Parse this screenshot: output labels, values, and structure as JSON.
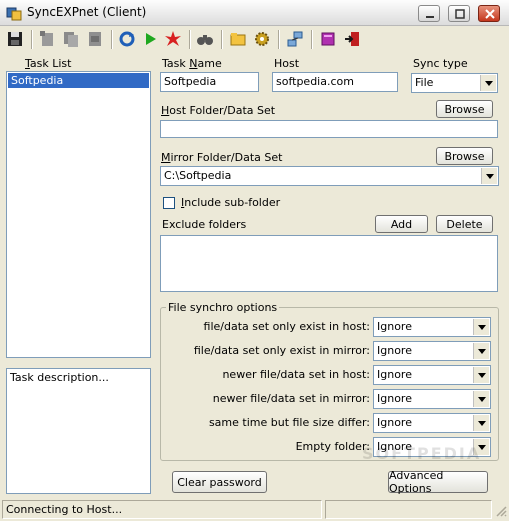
{
  "window": {
    "title": "SyncEXPnet (Client)"
  },
  "task_list": {
    "label_u": "T",
    "label_rest": "ask List",
    "items": [
      "Softpedia"
    ]
  },
  "task_description": {
    "placeholder": "Task description..."
  },
  "task_name": {
    "label_pre": "Task ",
    "label_u": "N",
    "label_post": "ame",
    "value": "Softpedia"
  },
  "host": {
    "label": "Host",
    "value": "softpedia.com"
  },
  "sync_type": {
    "label": "Sync type",
    "value": "File"
  },
  "host_folder": {
    "label_u": "H",
    "label_rest": "ost Folder/Data Set",
    "value": "",
    "browse_label": "Browse"
  },
  "mirror_folder": {
    "label_u": "M",
    "label_rest": "irror Folder/Data Set",
    "value": "C:\\Softpedia",
    "browse_label": "Browse"
  },
  "include_subfolder": {
    "label_u": "I",
    "label_rest": "nclude sub-folder",
    "checked": false
  },
  "exclude_folders": {
    "label": "Exclude folders",
    "add_label": "Add",
    "delete_label": "Delete"
  },
  "file_synchro": {
    "title": "File synchro options",
    "options": [
      {
        "label": "file/data set only exist in host:",
        "value": "Ignore"
      },
      {
        "label": "file/data set only exist in mirror:",
        "value": "Ignore"
      },
      {
        "label": "newer file/data set in host:",
        "value": "Ignore"
      },
      {
        "label": "newer file/data set in mirror:",
        "value": "Ignore"
      },
      {
        "label": "same time but file size differ:",
        "value": "Ignore"
      },
      {
        "label": "Empty folder:",
        "value": "Ignore"
      }
    ]
  },
  "buttons": {
    "clear_password": "Clear password",
    "advanced_options": "Advanced Options"
  },
  "status": {
    "text": "Connecting to Host..."
  },
  "watermark": "SOFTPEDIA",
  "colors": {
    "selection": "#316ac5",
    "field_border": "#7f9db9",
    "background": "#ece9d8"
  }
}
